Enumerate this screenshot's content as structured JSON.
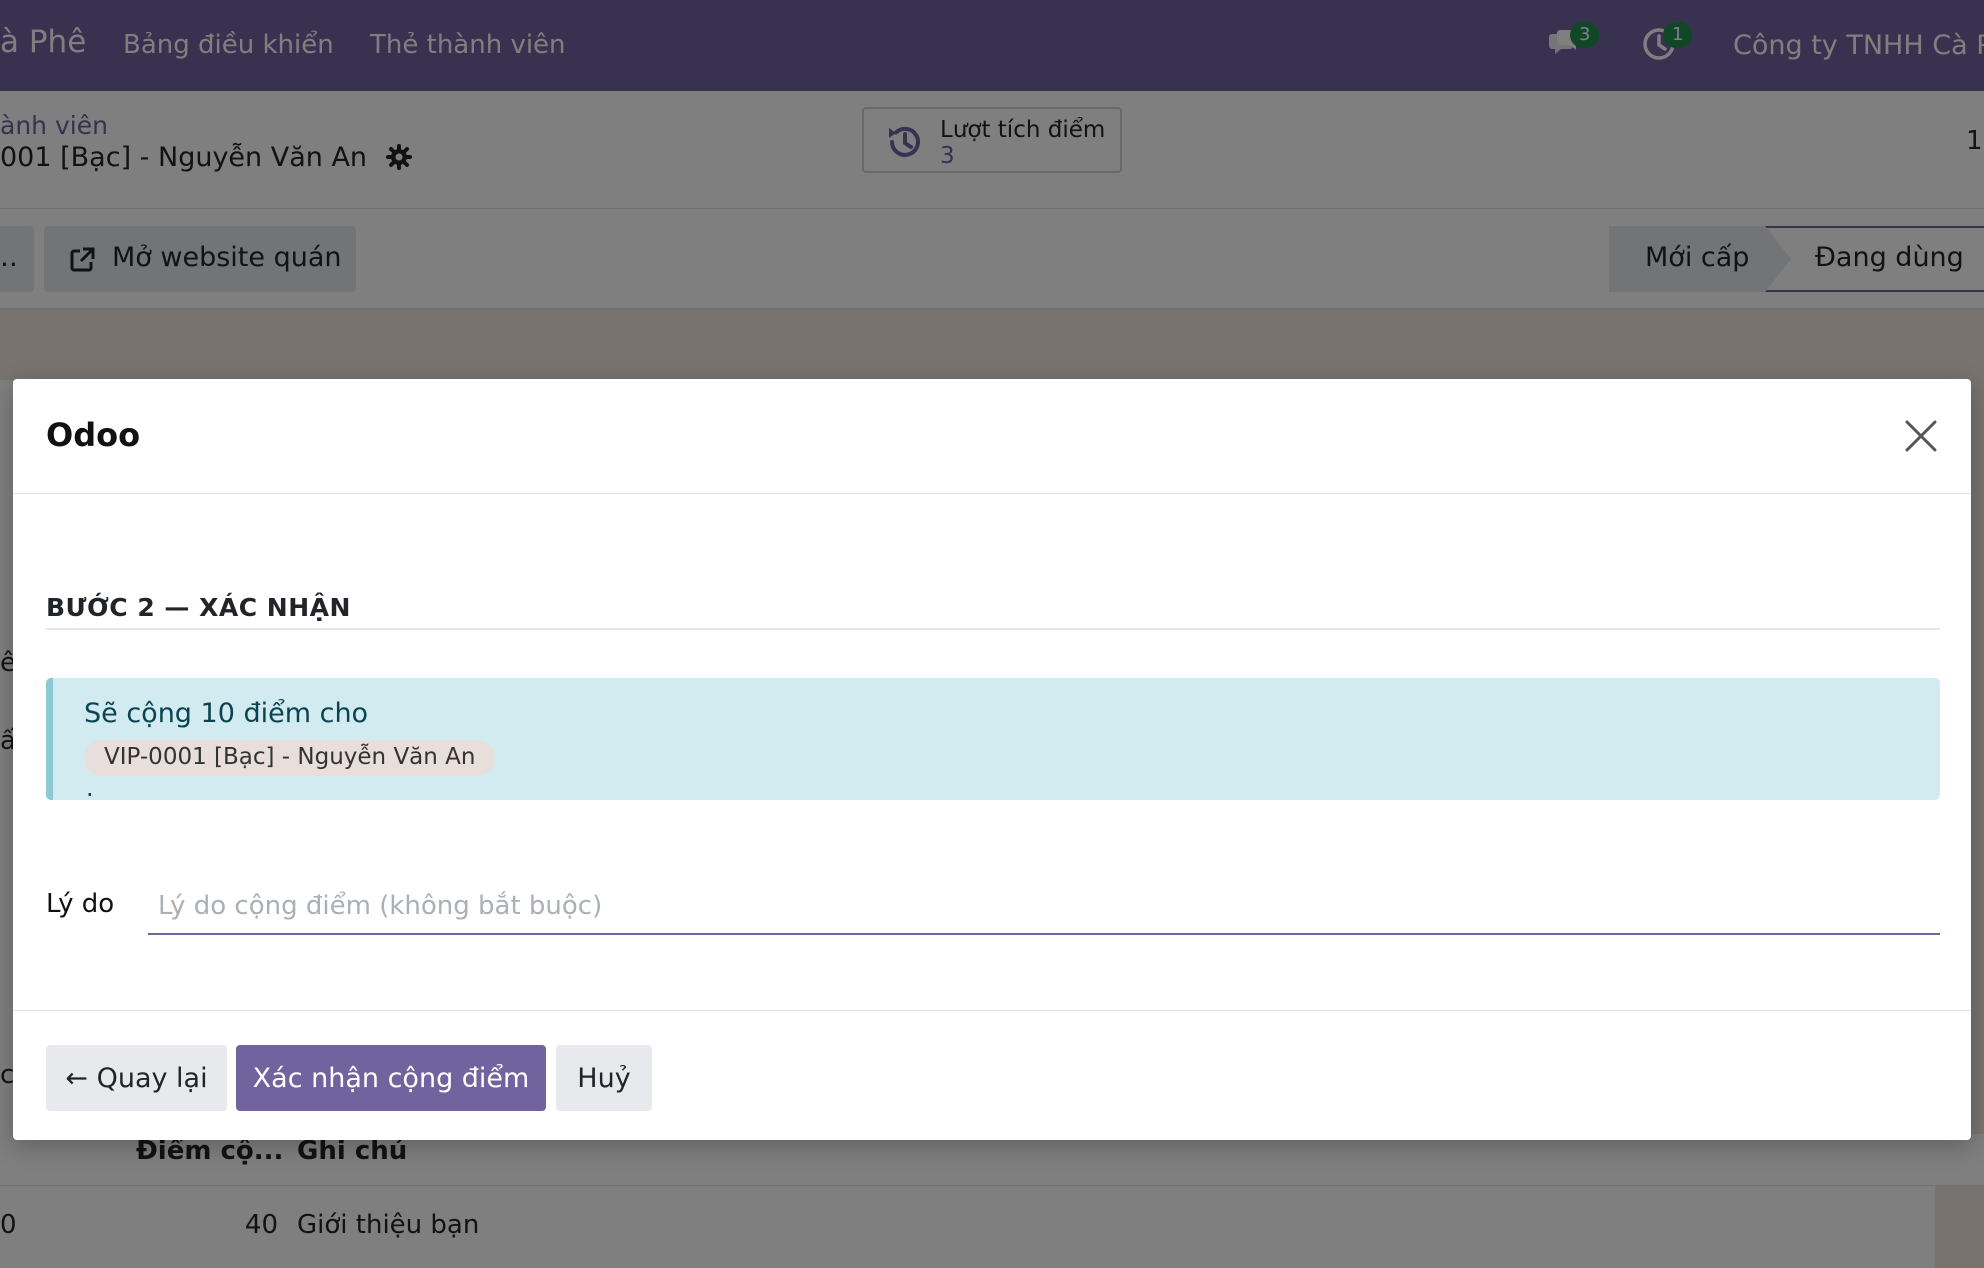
{
  "navbar": {
    "brand": "à Phê",
    "menu": [
      "Bảng điều khiển",
      "Thẻ thành viên"
    ],
    "messages_count": "3",
    "activities_count": "1",
    "company": "Công ty TNHH Cà P"
  },
  "breadcrumb": {
    "parent": "ành viên",
    "current": "001 [Bạc] - Nguyễn Văn An"
  },
  "smart_button": {
    "label": "Lượt tích điểm",
    "value": "3"
  },
  "pager": {
    "value": "1"
  },
  "actions": {
    "truncated": "..",
    "website": "Mở website quán"
  },
  "statusbar": {
    "stages": [
      "Mới cấp",
      "Đang dùng"
    ],
    "active": "Đang dùng"
  },
  "background_list": {
    "side_fragments": [
      "ê",
      "ấ",
      "c"
    ],
    "headers": [
      "Điểm cộ...",
      "Ghi chú"
    ],
    "rows": [
      {
        "cut": "0",
        "points": "40",
        "note": "Giới thiệu bạn"
      }
    ]
  },
  "modal": {
    "title": "Odoo",
    "section_title": "BƯỚC 2 — XÁC NHẬN",
    "alert": {
      "text": "Sẽ cộng 10 điểm cho",
      "member_tag": "VIP-0001 [Bạc] - Nguyễn Văn An",
      "trailing": "."
    },
    "reason": {
      "label": "Lý do",
      "value": "",
      "placeholder": "Lý do cộng điểm (không bắt buộc)"
    },
    "buttons": {
      "back": "← Quay lại",
      "confirm": "Xác nhận cộng điểm",
      "cancel": "Huỷ"
    }
  },
  "colors": {
    "brand": "#71639e",
    "alert_bg": "#d2ebf0",
    "alert_border": "#8dc9d4",
    "badge": "#1f8f4e"
  }
}
